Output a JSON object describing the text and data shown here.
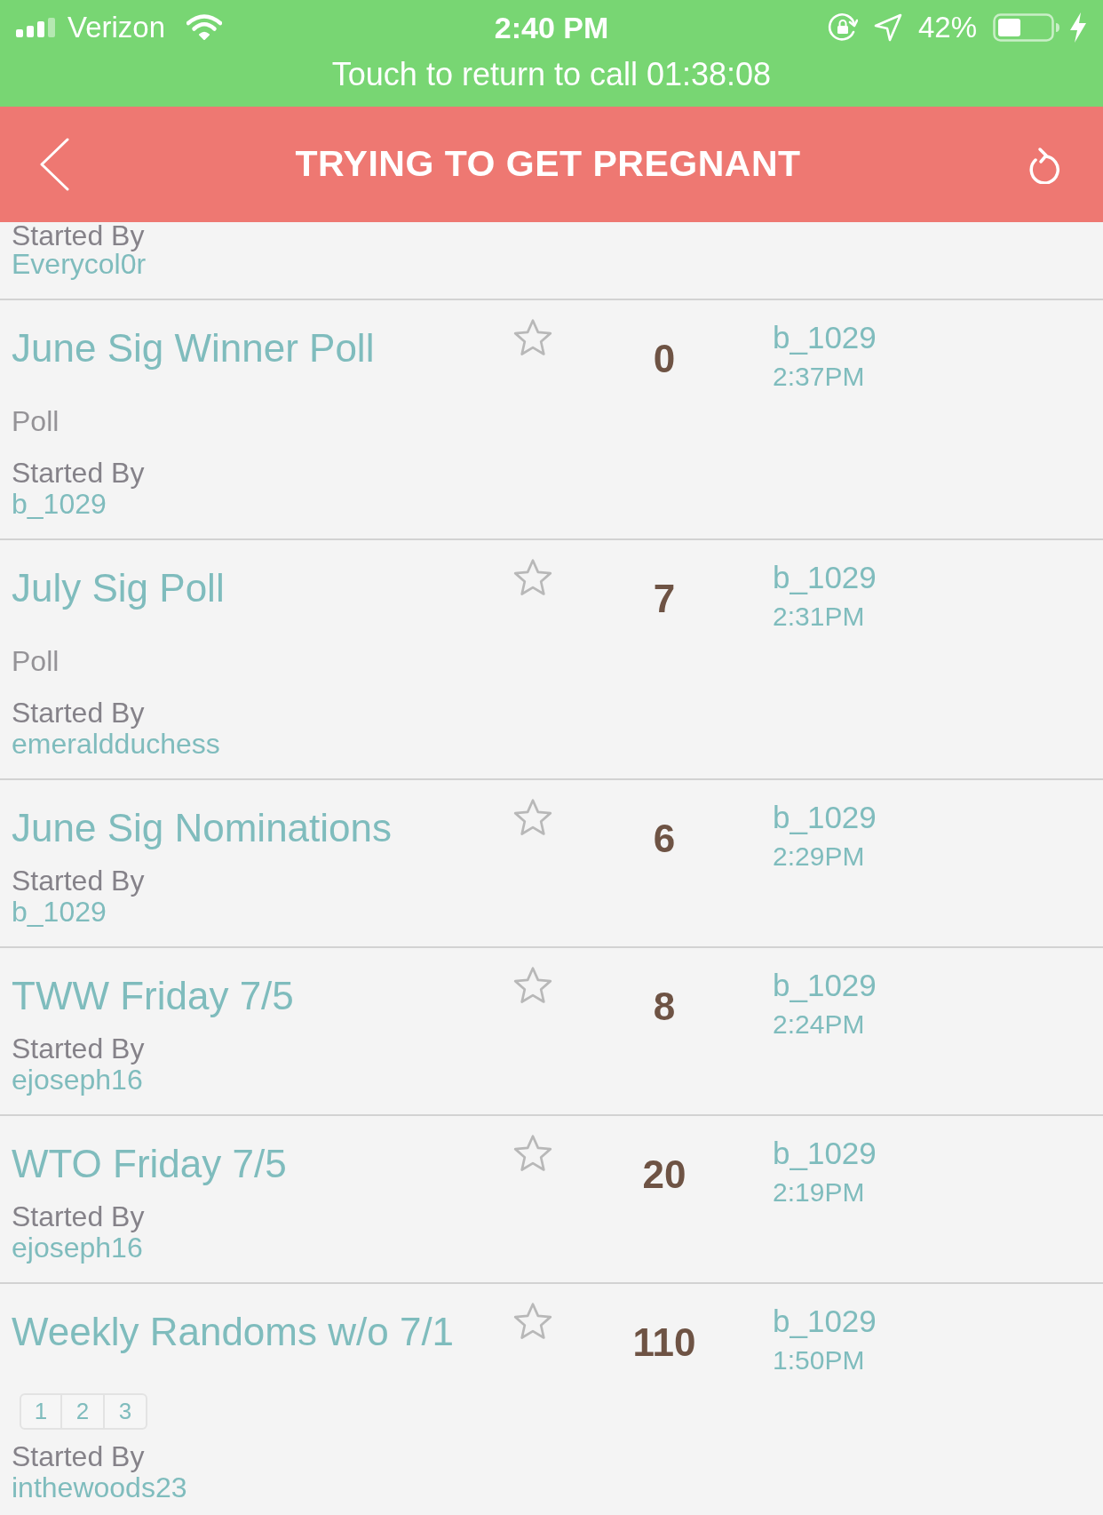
{
  "status_bar": {
    "carrier": "Verizon",
    "time": "2:40 PM",
    "battery_percent": "42%"
  },
  "call_banner": {
    "text": "Touch to return to call 01:38:08"
  },
  "header": {
    "title": "TRYING TO GET PREGNANT"
  },
  "partial_topic": {
    "started_by_label": "Started By",
    "author": "Everycol0r"
  },
  "topics": [
    {
      "title": "June Sig Winner Poll",
      "type_label": "Poll",
      "starred": false,
      "replies": "0",
      "last_poster": "b_1029",
      "last_time": "2:37PM",
      "started_by_label": "Started By",
      "author": "b_1029"
    },
    {
      "title": "July Sig Poll",
      "type_label": "Poll",
      "starred": false,
      "replies": "7",
      "last_poster": "b_1029",
      "last_time": "2:31PM",
      "started_by_label": "Started By",
      "author": "emeraldduchess"
    },
    {
      "title": "June Sig Nominations",
      "starred": false,
      "replies": "6",
      "last_poster": "b_1029",
      "last_time": "2:29PM",
      "started_by_label": "Started By",
      "author": "b_1029"
    },
    {
      "title": "TWW Friday 7/5",
      "starred": false,
      "replies": "8",
      "last_poster": "b_1029",
      "last_time": "2:24PM",
      "started_by_label": "Started By",
      "author": "ejoseph16"
    },
    {
      "title": "WTO Friday 7/5",
      "starred": false,
      "replies": "20",
      "last_poster": "b_1029",
      "last_time": "2:19PM",
      "started_by_label": "Started By",
      "author": "ejoseph16"
    },
    {
      "title": "Weekly Randoms w/o 7/1",
      "starred": false,
      "replies": "110",
      "last_poster": "b_1029",
      "last_time": "1:50PM",
      "started_by_label": "Started By",
      "author": "inthewoods23",
      "pages": [
        "1",
        "2",
        "3"
      ]
    }
  ]
}
